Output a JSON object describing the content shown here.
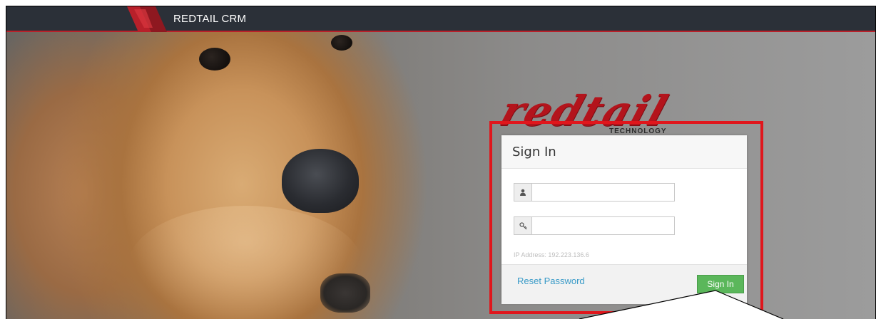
{
  "header": {
    "app_title": "REDTAIL CRM"
  },
  "brand": {
    "wordmark": "redtail",
    "tagline": "TECHNOLOGY"
  },
  "login": {
    "title": "Sign In",
    "username_value": "",
    "password_value": "",
    "ip_text": "IP Address: 192.223.136.6",
    "reset_label": "Reset Password",
    "submit_label": "Sign In"
  },
  "colors": {
    "topbar": "#2b3038",
    "brand_red": "#b3141c",
    "highlight": "#e0161c",
    "button_green": "#5bb75b",
    "link_blue": "#3a9bc8"
  },
  "icons": {
    "username": "user-icon",
    "password": "key-icon"
  }
}
